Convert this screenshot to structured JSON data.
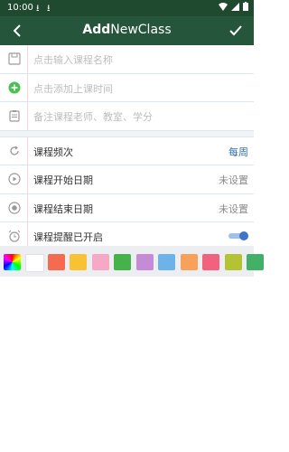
{
  "status": {
    "time": "10:00"
  },
  "toolbar": {
    "title_bold": "Add",
    "title_rest": "NewClass"
  },
  "form": {
    "course_name_placeholder": "点击输入课程名称",
    "time_placeholder": "点击添加上课时间",
    "note_placeholder": "备注课程老师、教室、学分",
    "frequency_label": "课程频次",
    "frequency_value": "每周",
    "start_label": "课程开始日期",
    "start_value": "未设置",
    "end_label": "课程结束日期",
    "end_value": "未设置",
    "reminder_label": "课程提醒已开启"
  },
  "palette": {
    "colors": [
      "#ffffff",
      "#f46b50",
      "#f9c235",
      "#f7a8c4",
      "#46b24a",
      "#c58bd6",
      "#6cb3ea",
      "#f7a15b",
      "#f2627f",
      "#b4c334",
      "#42b067"
    ]
  }
}
